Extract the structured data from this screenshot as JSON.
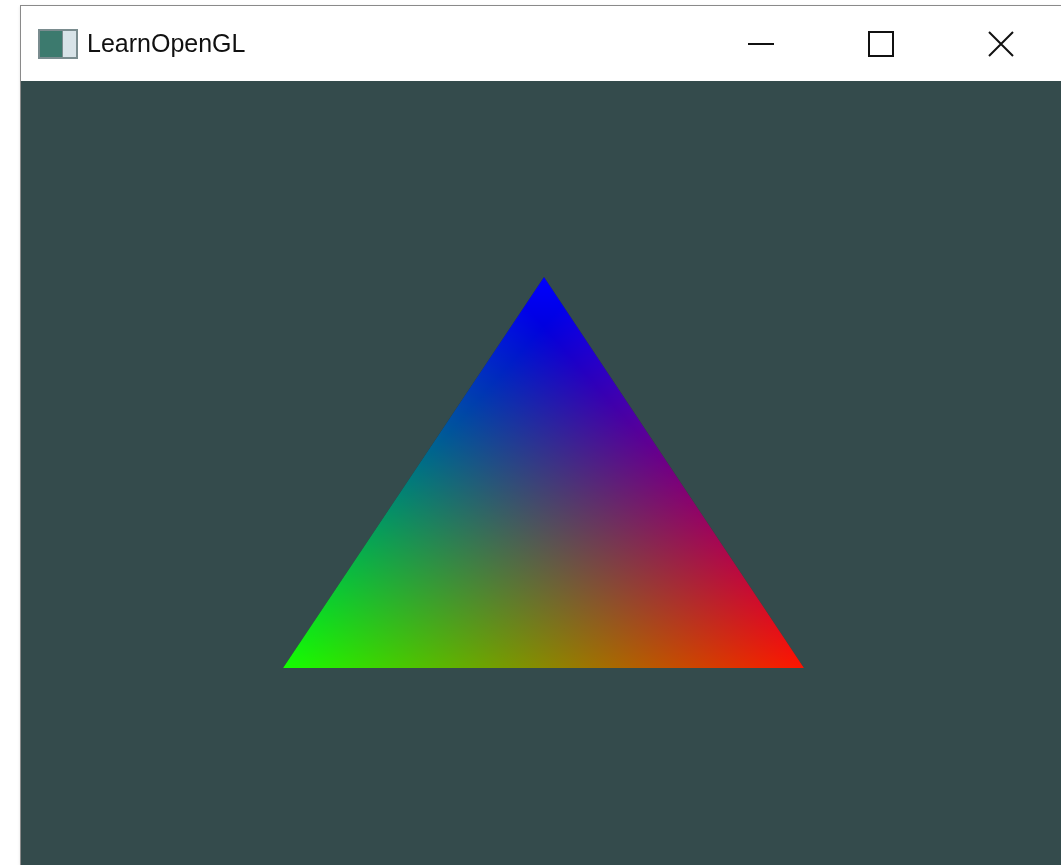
{
  "window": {
    "title": "LearnOpenGL"
  },
  "title_bar_buttons": [
    {
      "kind": "minimize"
    },
    {
      "kind": "maximize"
    },
    {
      "kind": "close"
    }
  ]
}
